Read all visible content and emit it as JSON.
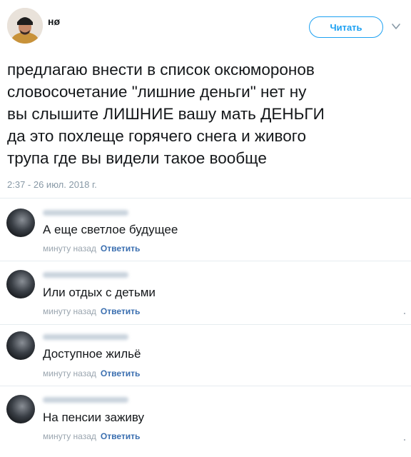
{
  "tweet": {
    "author_name": "нø",
    "follow_label": "Читать",
    "text_lines": [
      "предлагаю внести в список оксюморонов",
      "словосочетание \"лишние деньги\" нет ну",
      "вы слышите ЛИШНИЕ вашу мать ДЕНЬГИ",
      "да это похлеще горячего снега и живого",
      "трупа где вы видели такое вообще"
    ],
    "timestamp": "2:37 - 26 июл. 2018 г."
  },
  "comments": [
    {
      "text": "А еще светлое будущее",
      "time": "минуту назад",
      "reply_label": "Ответить"
    },
    {
      "text": "Или отдых с детьми",
      "time": "минуту назад",
      "reply_label": "Ответить"
    },
    {
      "text": "Доступное жильё",
      "time": "минуту назад",
      "reply_label": "Ответить"
    },
    {
      "text": "На пенсии заживу",
      "time": "минуту назад",
      "reply_label": "Ответить"
    }
  ],
  "icons": {
    "follow_chevron": "chevron-down-icon"
  },
  "colors": {
    "accent": "#1da1f2",
    "reply_link": "#3b6fb0",
    "meta_gray": "#9aa5af"
  }
}
